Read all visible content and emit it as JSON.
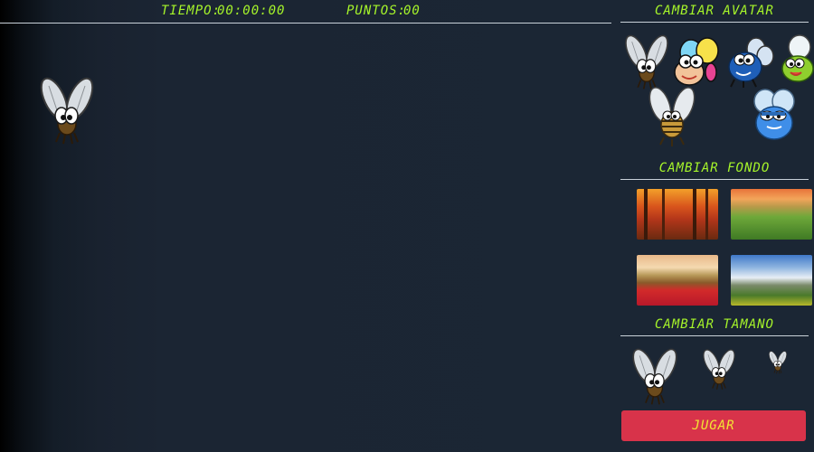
{
  "header": {
    "time_label": "TIEMPO:",
    "time_value": "00:00:00",
    "points_label": "PUNTOS:",
    "points_value": "00"
  },
  "sidebar": {
    "avatar_title": "CAMBIAR AVATAR",
    "avatars": [
      {
        "name": "gray-fly"
      },
      {
        "name": "cartoon-yellow-fly"
      },
      {
        "name": "blue-fly"
      },
      {
        "name": "green-fly"
      },
      {
        "name": "bee-fly"
      },
      {
        "name": "blue-bug"
      }
    ],
    "background_title": "CAMBIAR FONDO",
    "backgrounds": [
      {
        "name": "autumn-forest"
      },
      {
        "name": "green-hills-sunset"
      },
      {
        "name": "flower-meadow"
      },
      {
        "name": "snowy-mountains"
      }
    ],
    "size_title": "CAMBIAR TAMANO",
    "sizes": [
      {
        "name": "large"
      },
      {
        "name": "medium"
      },
      {
        "name": "small"
      }
    ],
    "play_label": "JUGAR"
  },
  "colors": {
    "accent_text": "#a6f52a",
    "play_button": "#d8334a",
    "play_text": "#f3e534",
    "divider": "#c9d1d9"
  }
}
